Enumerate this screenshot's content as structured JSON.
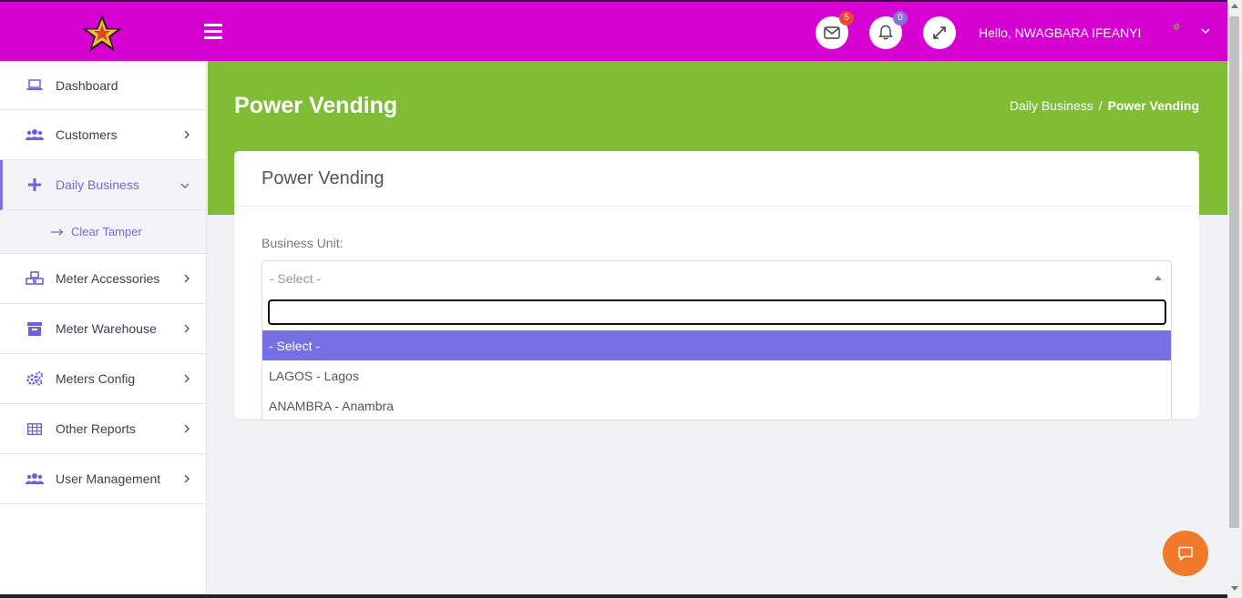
{
  "header": {
    "mail_count": "5",
    "notification_count": "0",
    "greeting": "Hello,  NWAGBARA IFEANYI",
    "bg_color": "#d600d2"
  },
  "sidebar": {
    "items": [
      {
        "label": "Dashboard",
        "icon": "laptop-icon"
      },
      {
        "label": "Customers",
        "icon": "users-icon"
      },
      {
        "label": "Daily Business",
        "icon": "plus-icon",
        "active": true
      },
      {
        "label": "Meter Accessories",
        "icon": "cubes-icon"
      },
      {
        "label": "Meter Warehouse",
        "icon": "archive-icon"
      },
      {
        "label": "Meters Config",
        "icon": "cogs-icon"
      },
      {
        "label": "Other Reports",
        "icon": "table-icon"
      },
      {
        "label": "User Management",
        "icon": "users-icon"
      }
    ],
    "subitem": {
      "label": "Clear Tamper",
      "icon": "arrow-right-icon"
    }
  },
  "page": {
    "title": "Power Vending",
    "breadcrumb": {
      "parent": "Daily Business",
      "separator": "/",
      "current": "Power Vending"
    },
    "accent_green": "#7ebd34"
  },
  "card": {
    "title": "Power Vending",
    "field_label": "Business Unit:",
    "select_value": "- Select -"
  },
  "dropdown": {
    "search_value": "",
    "options": [
      "- Select -",
      "LAGOS - Lagos",
      "ANAMBRA - Anambra"
    ],
    "selected_index": 0,
    "highlight_color": "#7570e4"
  }
}
